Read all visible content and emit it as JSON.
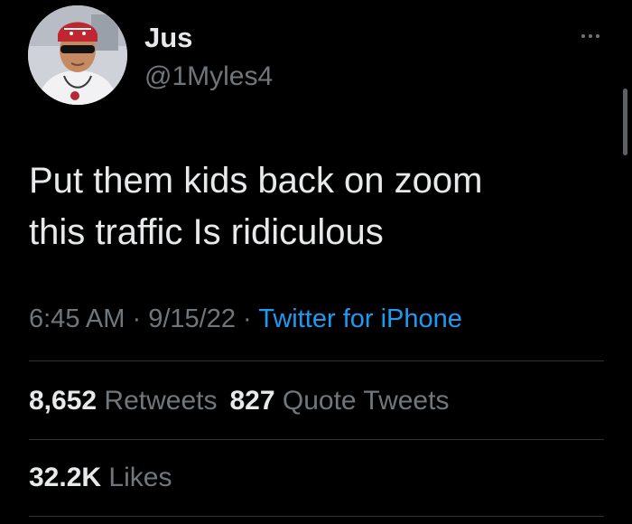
{
  "author": {
    "display_name": "Jus",
    "handle": "@1Myles4"
  },
  "tweet": {
    "text_lines": [
      "Put them kids back on zoom",
      "this traffic Is ridiculous"
    ]
  },
  "meta": {
    "time": "6:45 AM",
    "separator": "·",
    "date": "9/15/22",
    "source": "Twitter for iPhone"
  },
  "stats": {
    "retweets_count": "8,652",
    "retweets_label": "Retweets",
    "quotes_count": "827",
    "quotes_label": "Quote Tweets",
    "likes_count": "32.2K",
    "likes_label": "Likes"
  },
  "icons": {
    "more": "more-options-icon"
  },
  "colors": {
    "background": "#000000",
    "text_primary": "#e7e9ea",
    "text_secondary": "#71767b",
    "link": "#1d9bf0",
    "divider": "#2f3336"
  }
}
